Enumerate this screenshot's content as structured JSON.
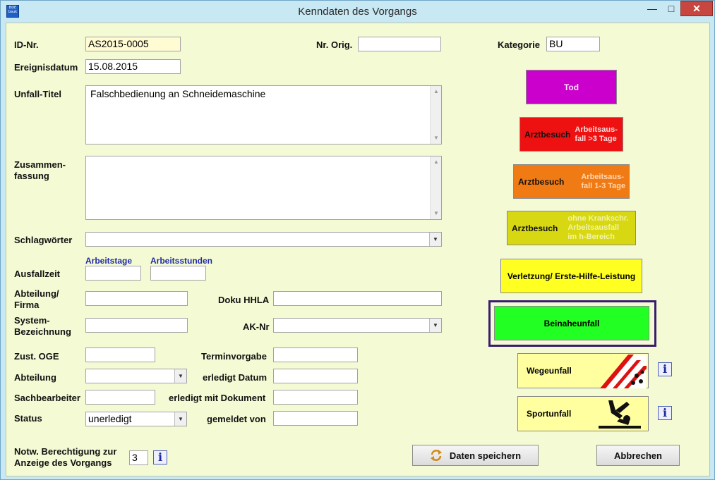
{
  "window": {
    "title": "Kenndaten des Vorgangs",
    "icon_text": "BDE bauk",
    "minimize": "—",
    "maximize": "□",
    "close": "✕"
  },
  "form": {
    "id_label": "ID-Nr.",
    "id_value": "AS2015-0005",
    "nr_orig_label": "Nr. Orig.",
    "nr_orig_value": "",
    "kategorie_label": "Kategorie",
    "kategorie_value": "BU",
    "ereignisdatum_label": "Ereignisdatum",
    "ereignisdatum_value": "15.08.2015",
    "unfall_titel_label": "Unfall-Titel",
    "unfall_titel_value": "Falschbedienung an Schneidemaschine",
    "zusammenfassung_label_1": "Zusammen-",
    "zusammenfassung_label_2": "fassung",
    "zusammenfassung_value": "",
    "schlagwoerter_label": "Schlagwörter",
    "schlagwoerter_value": "",
    "arbeitstage_label": "Arbeitstage",
    "arbeitsstunden_label": "Arbeitsstunden",
    "ausfallzeit_label": "Ausfallzeit",
    "abteilung_firma_label_1": "Abteilung/",
    "abteilung_firma_label_2": "Firma",
    "doku_hhla_label": "Doku HHLA",
    "system_label_1": "System-",
    "system_label_2": "Bezeichnung",
    "ak_nr_label": "AK-Nr",
    "zust_oge_label": "Zust. OGE",
    "terminvorgabe_label": "Terminvorgabe",
    "abteilung_label": "Abteilung",
    "erledigt_datum_label": "erledigt Datum",
    "sachbearbeiter_label": "Sachbearbeiter",
    "erledigt_dokument_label": "erledigt mit Dokument",
    "status_label": "Status",
    "status_value": "unerledigt",
    "gemeldet_von_label": "gemeldet von",
    "notw_label_1": "Notw. Berechtigung zur",
    "notw_label_2": "Anzeige des Vorgangs",
    "notw_value": "3"
  },
  "categories": {
    "tod": "Tod",
    "arzt_rot_a": "Arztbesuch",
    "arzt_rot_b1": "Arbeitsaus-",
    "arzt_rot_b2": "fall  >3 Tage",
    "arzt_orange_a": "Arztbesuch",
    "arzt_orange_b1": "Arbeitsaus-",
    "arzt_orange_b2": "fall  1-3 Tage",
    "arzt_gelb_a": "Arztbesuch",
    "arzt_gelb_b1": "ohne Krankschr.",
    "arzt_gelb_b2": "Arbeitsausfall",
    "arzt_gelb_b3": "im h-Bereich",
    "verletzung": "Verletzung/ Erste-Hilfe-Leistung",
    "beinaheunfall": "Beinaheunfall",
    "wegeunfall": "Wegeunfall",
    "sportunfall": "Sportunfall"
  },
  "buttons": {
    "save": "Daten speichern",
    "cancel": "Abbrechen",
    "info": "i"
  },
  "colors": {
    "tod": "#cc00cc",
    "arzt_rot": "#ee1111",
    "arzt_orange": "#f07a14",
    "arzt_gelb": "#d8d812",
    "verletzung": "#ffff22",
    "beinaheunfall": "#22ff22",
    "wege_sport": "#ffffa0",
    "selection_border": "#3a1e6e"
  }
}
